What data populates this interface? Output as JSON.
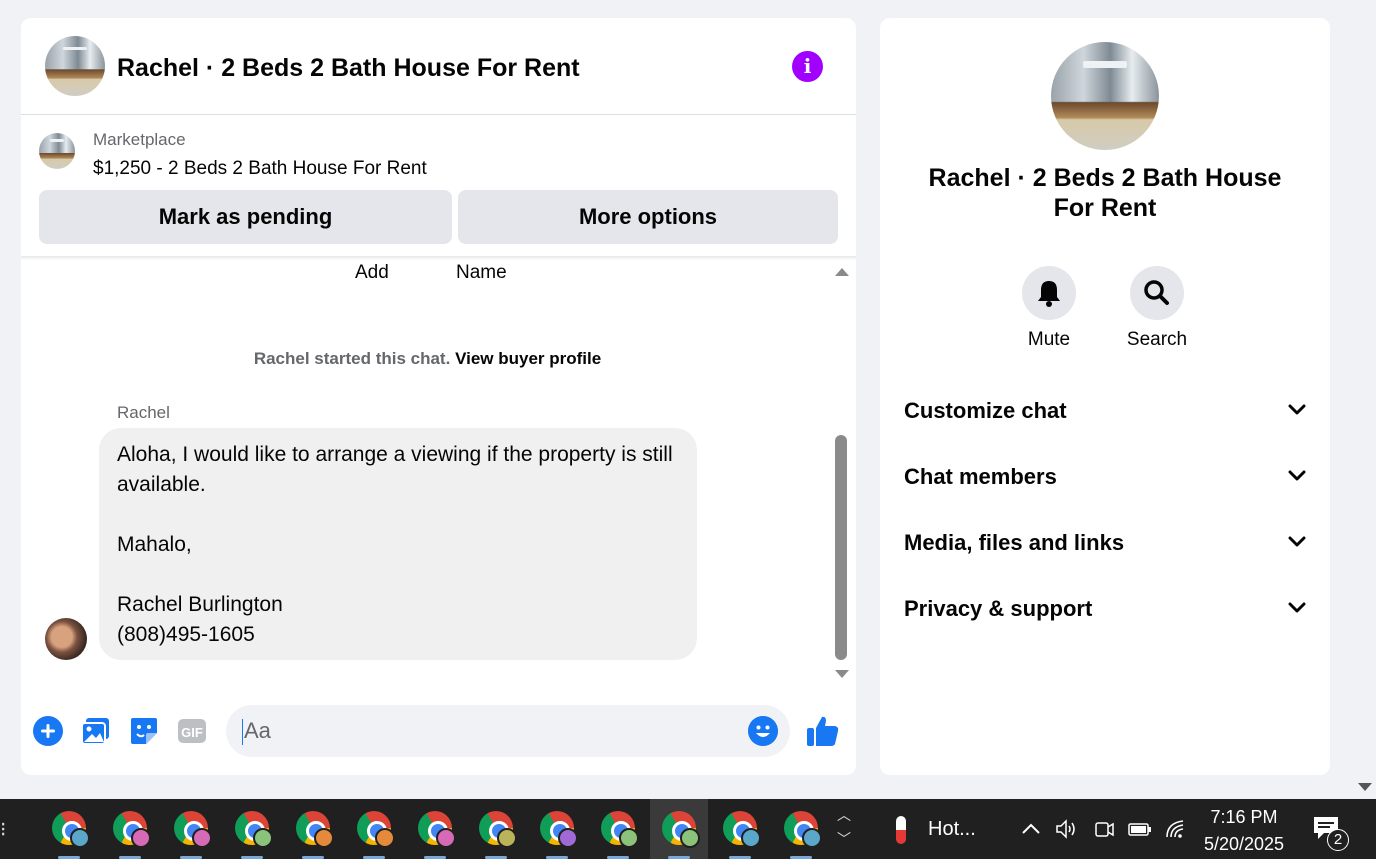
{
  "chat": {
    "title": "Rachel · 2 Beds 2 Bath House For Rent",
    "listing": {
      "source": "Marketplace",
      "title": "$1,250 - 2 Beds 2 Bath House For Rent"
    },
    "actions": {
      "pending_label": "Mark as pending",
      "more_label": "More options"
    },
    "faded_labels": [
      "Add",
      "Name"
    ],
    "started": {
      "text": "Rachel started this chat.",
      "link": "View buyer profile"
    },
    "message": {
      "sender": "Rachel",
      "body": "Aloha, I would like to arrange a viewing if the property is still available.\n\nMahalo,\n\nRachel Burlington\n(808)495-1605"
    },
    "composer": {
      "placeholder": "Aa"
    },
    "accent_color": "#1877f2",
    "info_color": "#a100ff"
  },
  "info_panel": {
    "title": "Rachel · 2 Beds 2 Bath House For Rent",
    "mute_label": "Mute",
    "search_label": "Search",
    "sections": [
      "Customize chat",
      "Chat members",
      "Media, files and links",
      "Privacy & support"
    ]
  },
  "taskbar": {
    "weather": "Hot...",
    "time": "7:16 PM",
    "date": "5/20/2025",
    "notification_count": "2",
    "app_badge_colors": [
      "#5aa7c9",
      "#d76ab6",
      "#d76ab6",
      "#8bc37a",
      "#e58a3a",
      "#e58a3a",
      "#d76ab6",
      "#b9b45a",
      "#a06ad6",
      "#8bc37a",
      "#8bc37a",
      "#5aa7c9",
      "#5aa7c9"
    ]
  }
}
